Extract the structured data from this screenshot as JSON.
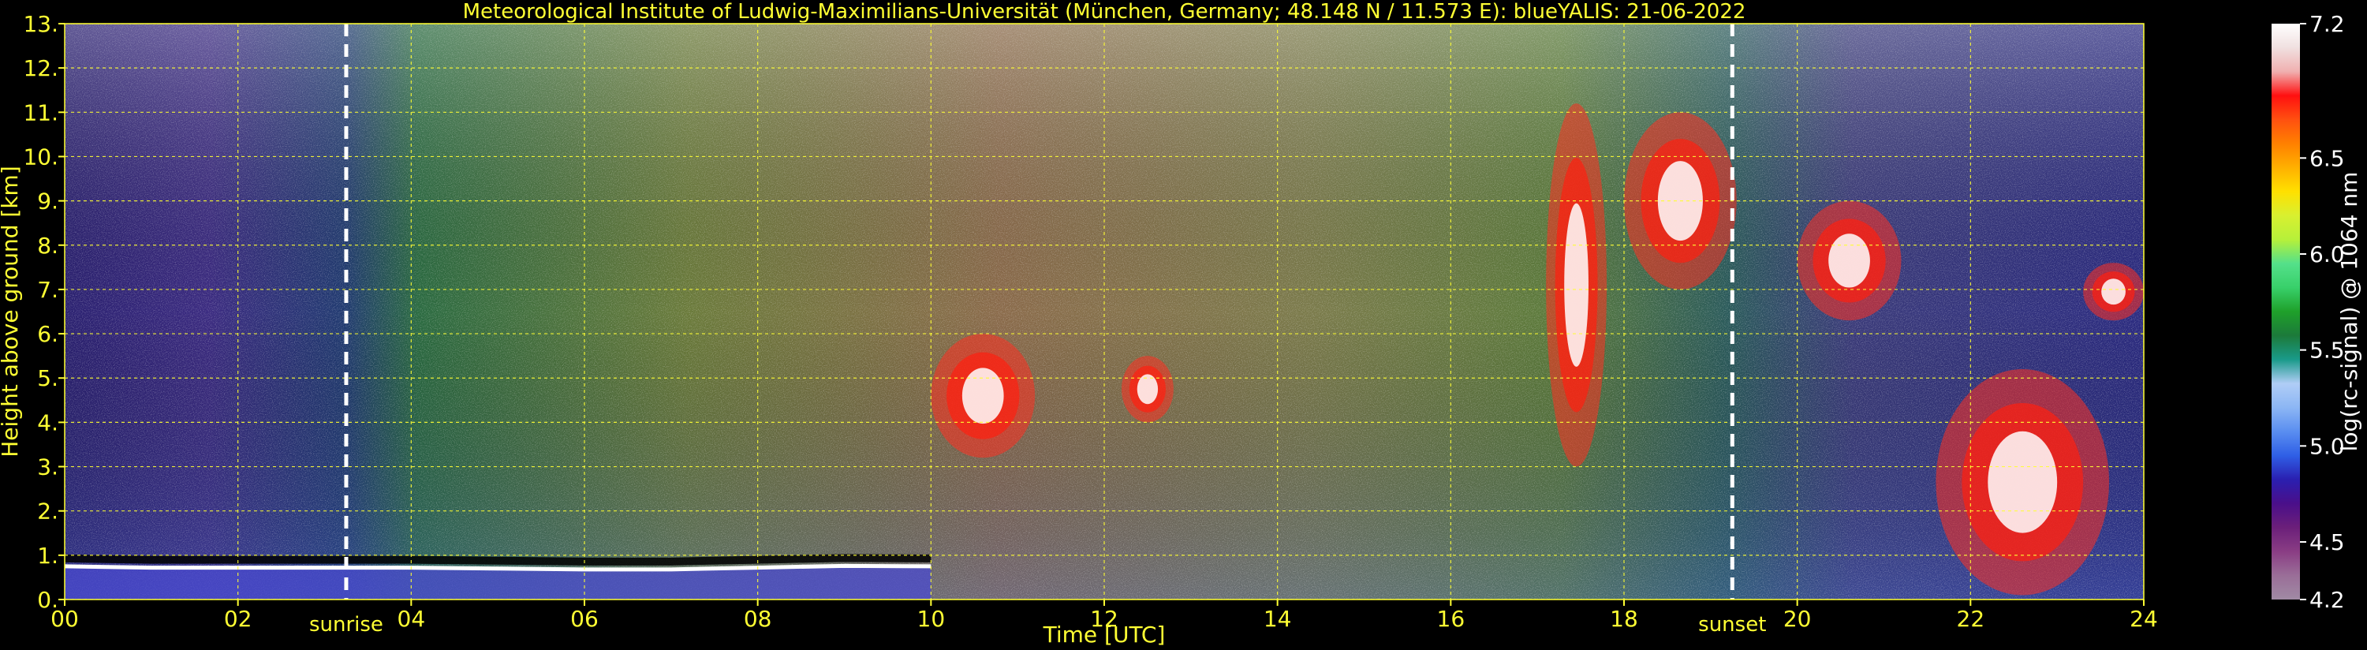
{
  "chart_data": {
    "type": "heatmap",
    "title": "Meteorological Institute of Ludwig-Maximilians-Universität (München, Germany; 48.148 N / 11.573 E):    blueYALIS: 21-06-2022",
    "xlabel": "Time [UTC]",
    "ylabel": "Height above ground [km]",
    "xlim": [
      0,
      24
    ],
    "ylim": [
      0,
      13
    ],
    "x_ticks": [
      0,
      2,
      4,
      6,
      8,
      10,
      12,
      14,
      16,
      18,
      20,
      22,
      24
    ],
    "x_tick_labels": [
      "00",
      "02",
      "04",
      "06",
      "08",
      "10",
      "12",
      "14",
      "16",
      "18",
      "20",
      "22",
      "24"
    ],
    "y_ticks": [
      0,
      1,
      2,
      3,
      4,
      5,
      6,
      7,
      8,
      9,
      10,
      11,
      12,
      13
    ],
    "y_tick_labels": [
      "0.",
      "1.",
      "2.",
      "3.",
      "4.",
      "5.",
      "6.",
      "7.",
      "8.",
      "9.",
      "10.",
      "11.",
      "12.",
      "13."
    ],
    "grid": true,
    "annotations": [
      {
        "label": "sunrise",
        "x": 3.25
      },
      {
        "label": "sunset",
        "x": 19.25
      }
    ],
    "colorbar": {
      "label": "log(rc-signal) @ 1064 nm",
      "range": [
        4.2,
        7.2
      ],
      "ticks": [
        4.2,
        4.5,
        5.0,
        5.5,
        6.0,
        6.5,
        7.2
      ],
      "tick_labels": [
        "4.2",
        "4.5",
        "5.0",
        "5.5",
        "6.0",
        "6.5",
        "7.2"
      ],
      "colors": [
        "#a08aa4",
        "#9a6e98",
        "#8a3d84",
        "#6b1f7a",
        "#4a0f8a",
        "#2a1fb0",
        "#2f5fe6",
        "#5a8ef0",
        "#8cb6f4",
        "#b0cdf6",
        "#1a9a8a",
        "#1c7a3a",
        "#1fa02a",
        "#38d06a",
        "#54e08a",
        "#b6f03a",
        "#d8f030",
        "#ffe000",
        "#ffb000",
        "#ff8000",
        "#ff5010",
        "#ff1010",
        "#f0b0b0",
        "#f0e0e0",
        "#ffffff"
      ]
    },
    "features": [
      {
        "label": "boundary layer top",
        "t": [
          0,
          1,
          2,
          3,
          4,
          5,
          6,
          7,
          8,
          9,
          10
        ],
        "h": [
          0.75,
          0.72,
          0.72,
          0.72,
          0.72,
          0.7,
          0.68,
          0.68,
          0.72,
          0.76,
          0.75
        ]
      },
      {
        "label": "cloud",
        "t0": 10.0,
        "t1": 11.2,
        "h0": 3.2,
        "h1": 6.0
      },
      {
        "label": "cloud",
        "t0": 12.2,
        "t1": 12.8,
        "h0": 4.0,
        "h1": 5.5
      },
      {
        "label": "cloud",
        "t0": 17.1,
        "t1": 17.8,
        "h0": 3.0,
        "h1": 11.2
      },
      {
        "label": "cloud",
        "t0": 18.0,
        "t1": 19.3,
        "h0": 7.0,
        "h1": 11.0
      },
      {
        "label": "cloud",
        "t0": 20.0,
        "t1": 21.2,
        "h0": 6.3,
        "h1": 9.0
      },
      {
        "label": "cloud",
        "t0": 21.6,
        "t1": 23.6,
        "h0": 0.1,
        "h1": 5.2
      },
      {
        "label": "cloud",
        "t0": 23.3,
        "t1": 24.0,
        "h0": 6.3,
        "h1": 7.6
      }
    ]
  }
}
